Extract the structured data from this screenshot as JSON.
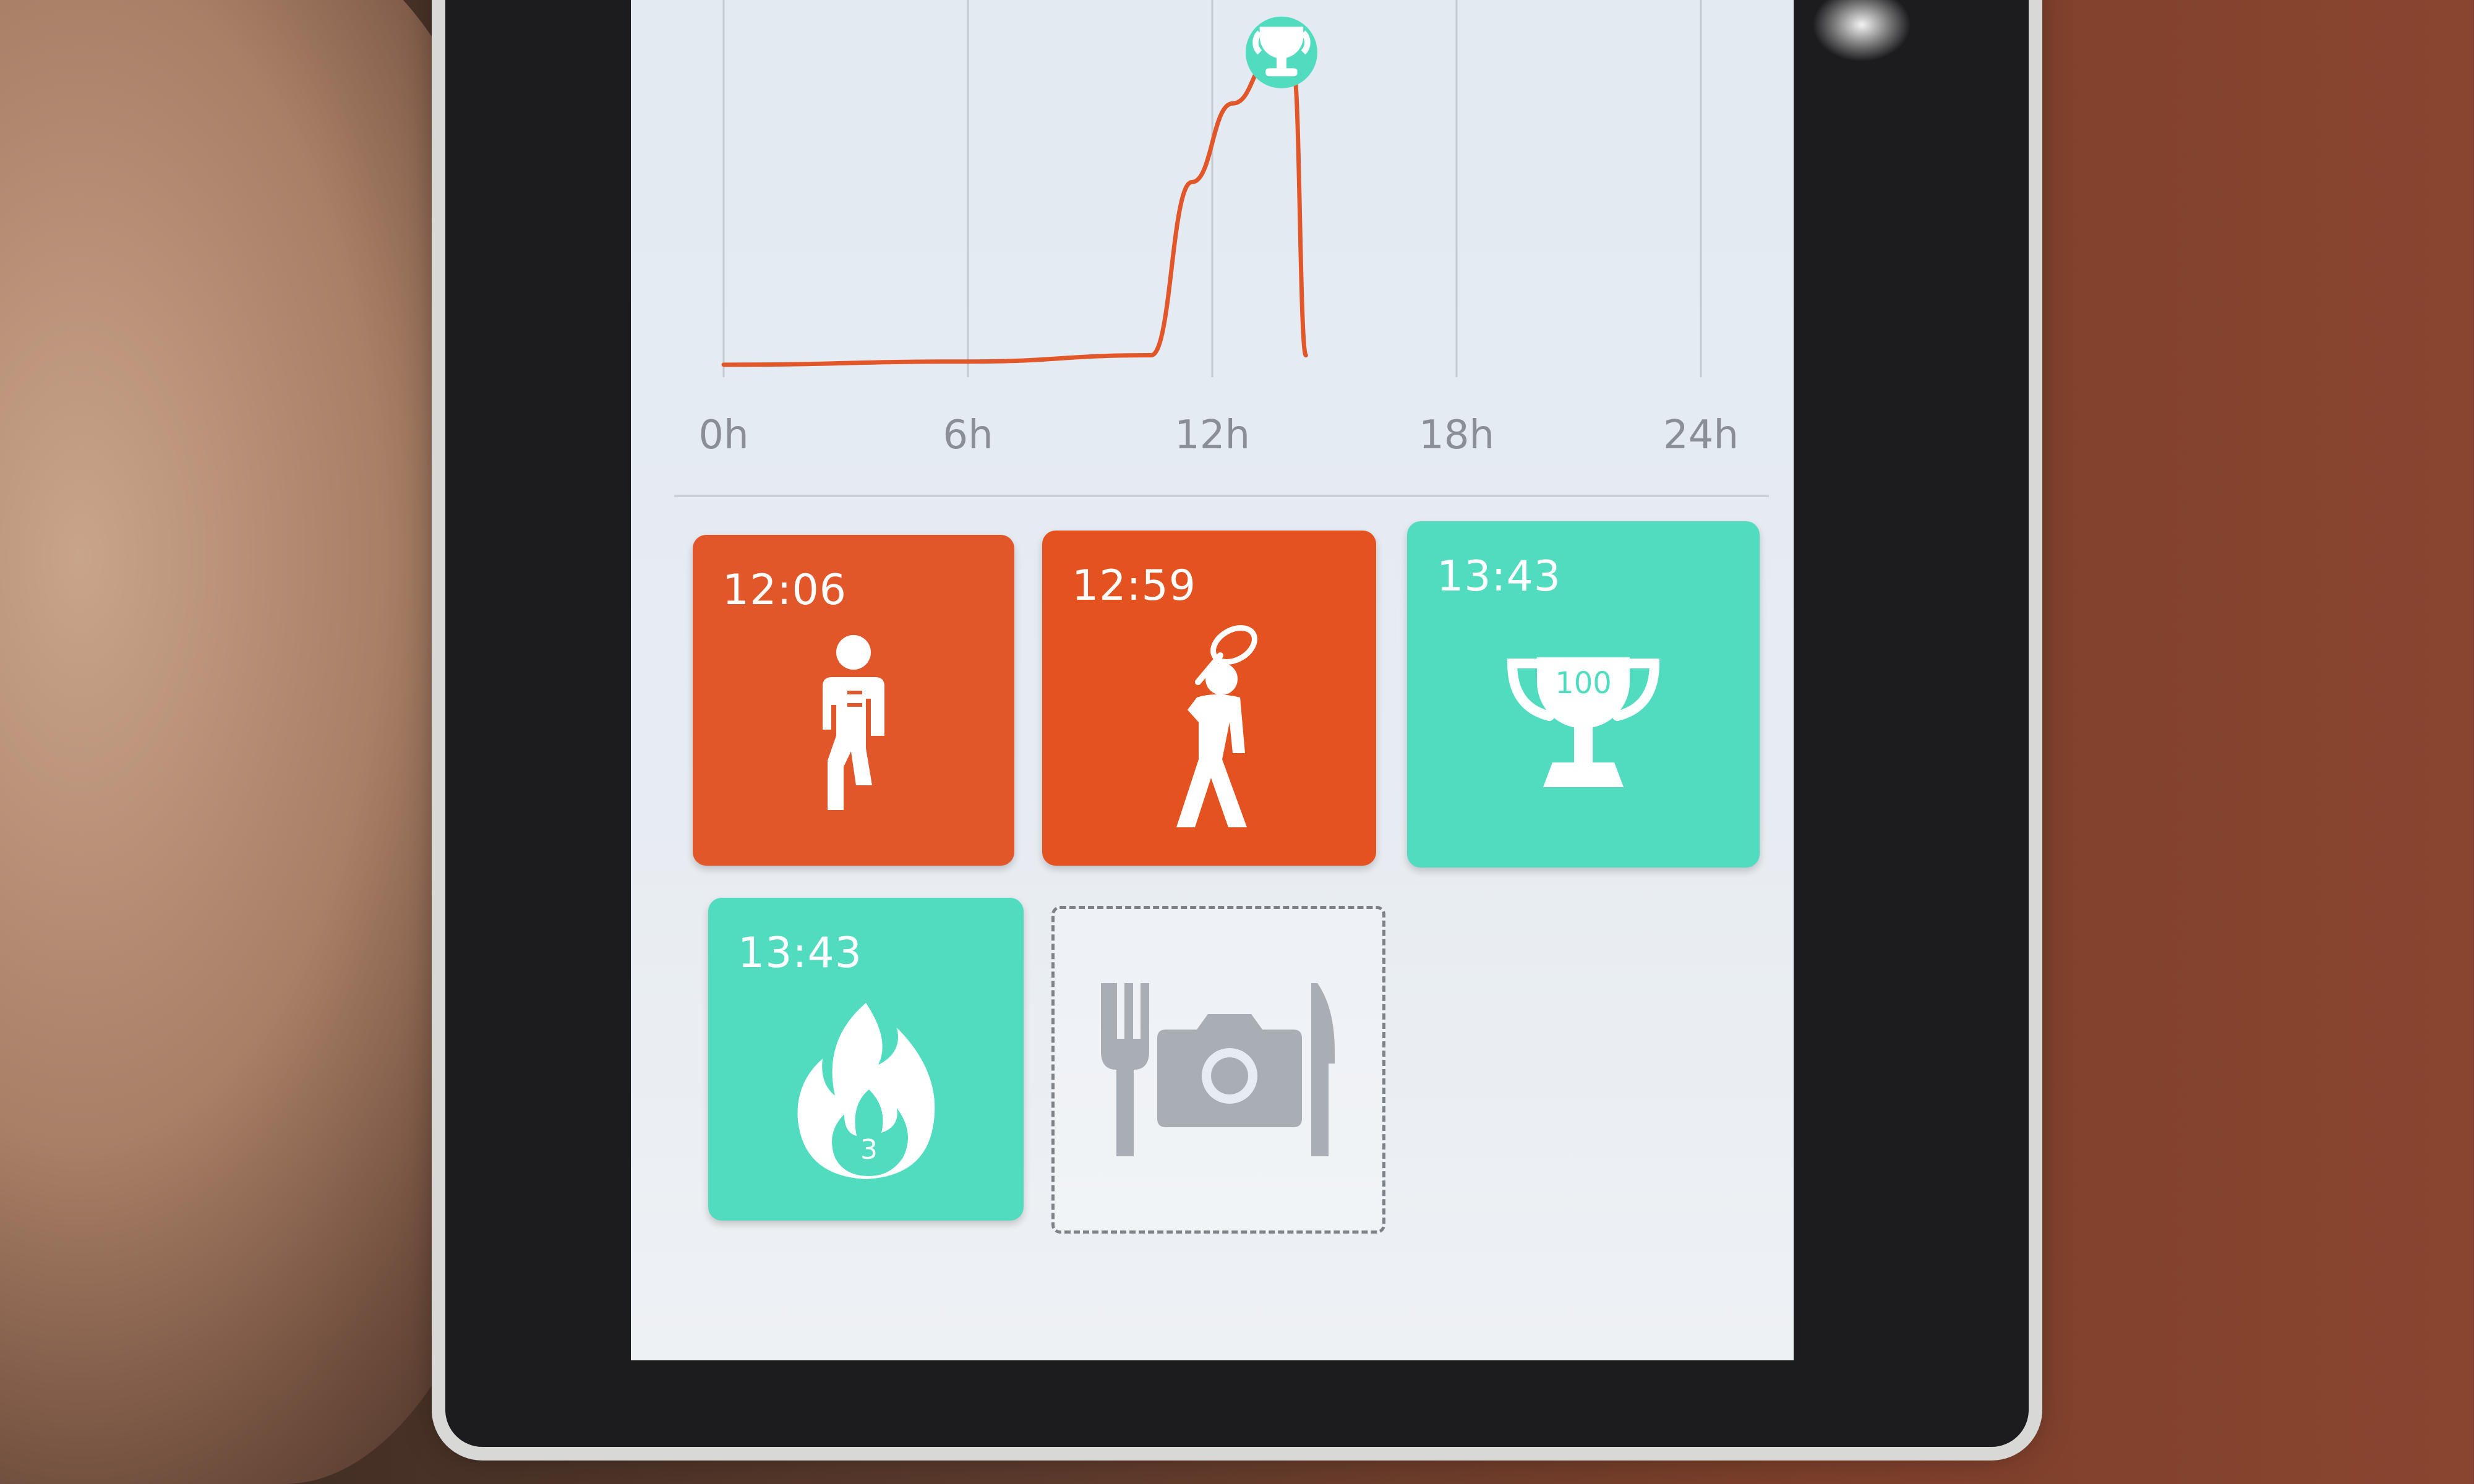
{
  "chart_data": {
    "type": "line",
    "x_ticks": [
      "0h",
      "6h",
      "12h",
      "18h",
      "24h"
    ],
    "x": [
      0,
      6,
      10.5,
      11.5,
      12.5,
      13.5,
      14.0,
      14.3
    ],
    "y": [
      2,
      3,
      5,
      60,
      85,
      100,
      95,
      5
    ],
    "xlim": [
      0,
      24
    ],
    "ylim": [
      0,
      110
    ],
    "grid": true,
    "marker": {
      "x": 13.7,
      "icon": "trophy-icon"
    },
    "line_color": "#e2572a",
    "marker_color": "#52dcbf"
  },
  "tiles": [
    {
      "time": "12:06",
      "icon": "running-icon",
      "color": "#e2572a"
    },
    {
      "time": "12:59",
      "icon": "tennis-icon",
      "color": "#e4521f"
    },
    {
      "time": "13:43",
      "icon": "trophy-icon",
      "badge": "100",
      "color": "#52dcbf"
    },
    {
      "time": "13:43",
      "icon": "flame-icon",
      "badge": "3",
      "color": "#52dcbf"
    }
  ],
  "meal_tile": {
    "icon": "meal-camera-icon"
  }
}
